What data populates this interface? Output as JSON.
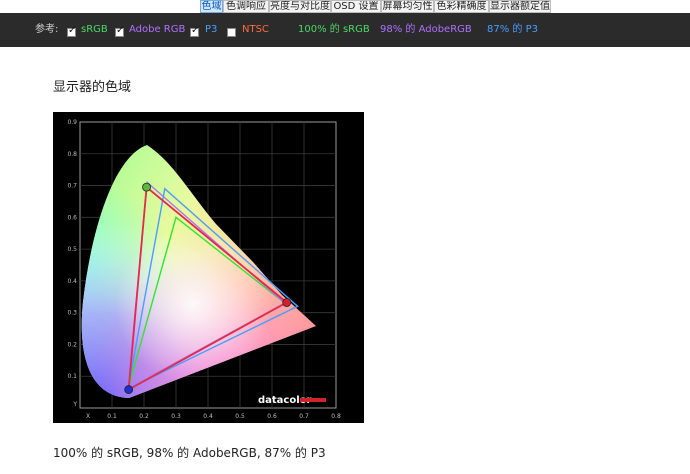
{
  "tabs": [
    {
      "label": "色域",
      "active": true
    },
    {
      "label": "色调响应",
      "active": false
    },
    {
      "label": "亮度与对比度",
      "active": false
    },
    {
      "label": "OSD 设置",
      "active": false
    },
    {
      "label": "屏幕均匀性",
      "active": false
    },
    {
      "label": "色彩精确度",
      "active": false
    },
    {
      "label": "显示器额定值",
      "active": false
    }
  ],
  "filter": {
    "prefix": "参考:",
    "options": [
      {
        "label": "sRGB",
        "checked": true,
        "color": "#4cd964"
      },
      {
        "label": "Adobe RGB",
        "checked": true,
        "color": "#b070ff"
      },
      {
        "label": "P3",
        "checked": true,
        "color": "#4a9dff"
      },
      {
        "label": "NTSC",
        "checked": false,
        "color": "#ff6a3a"
      }
    ],
    "results": [
      {
        "text": "100% 的 sRGB",
        "color": "#4cd964"
      },
      {
        "text": "98% 的 AdobeRGB",
        "color": "#b070ff"
      },
      {
        "text": "87% 的 P3",
        "color": "#4a9dff"
      }
    ]
  },
  "section_title": "显示器的色域",
  "chart_data": {
    "type": "scatter",
    "xlim": [
      0,
      0.8
    ],
    "ylim": [
      0,
      0.9
    ],
    "x_ticks": [
      "X",
      "0.1",
      "0.2",
      "0.3",
      "0.4",
      "0.5",
      "0.6",
      "0.7",
      "0.8"
    ],
    "y_ticks": [
      "Y",
      "0.1",
      "0.2",
      "0.3",
      "0.4",
      "0.5",
      "0.6",
      "0.7",
      "0.8",
      "0.9"
    ],
    "grid": true,
    "series": [
      {
        "name": "sRGB",
        "color": "#2ee62e",
        "points": [
          [
            0.64,
            0.33
          ],
          [
            0.3,
            0.6
          ],
          [
            0.15,
            0.06
          ]
        ]
      },
      {
        "name": "AdobeRGB",
        "color": "#b070ff",
        "points": [
          [
            0.64,
            0.33
          ],
          [
            0.21,
            0.71
          ],
          [
            0.15,
            0.06
          ]
        ]
      },
      {
        "name": "P3",
        "color": "#4a9dff",
        "points": [
          [
            0.68,
            0.32
          ],
          [
            0.265,
            0.69
          ],
          [
            0.15,
            0.06
          ]
        ]
      },
      {
        "name": "Display",
        "color": "#e8284a",
        "points": [
          [
            0.646,
            0.332
          ],
          [
            0.208,
            0.695
          ],
          [
            0.152,
            0.058
          ]
        ]
      }
    ],
    "watermark": "datacolor"
  },
  "caption": "100% 的 sRGB, 98% 的 AdobeRGB, 87% 的 P3"
}
